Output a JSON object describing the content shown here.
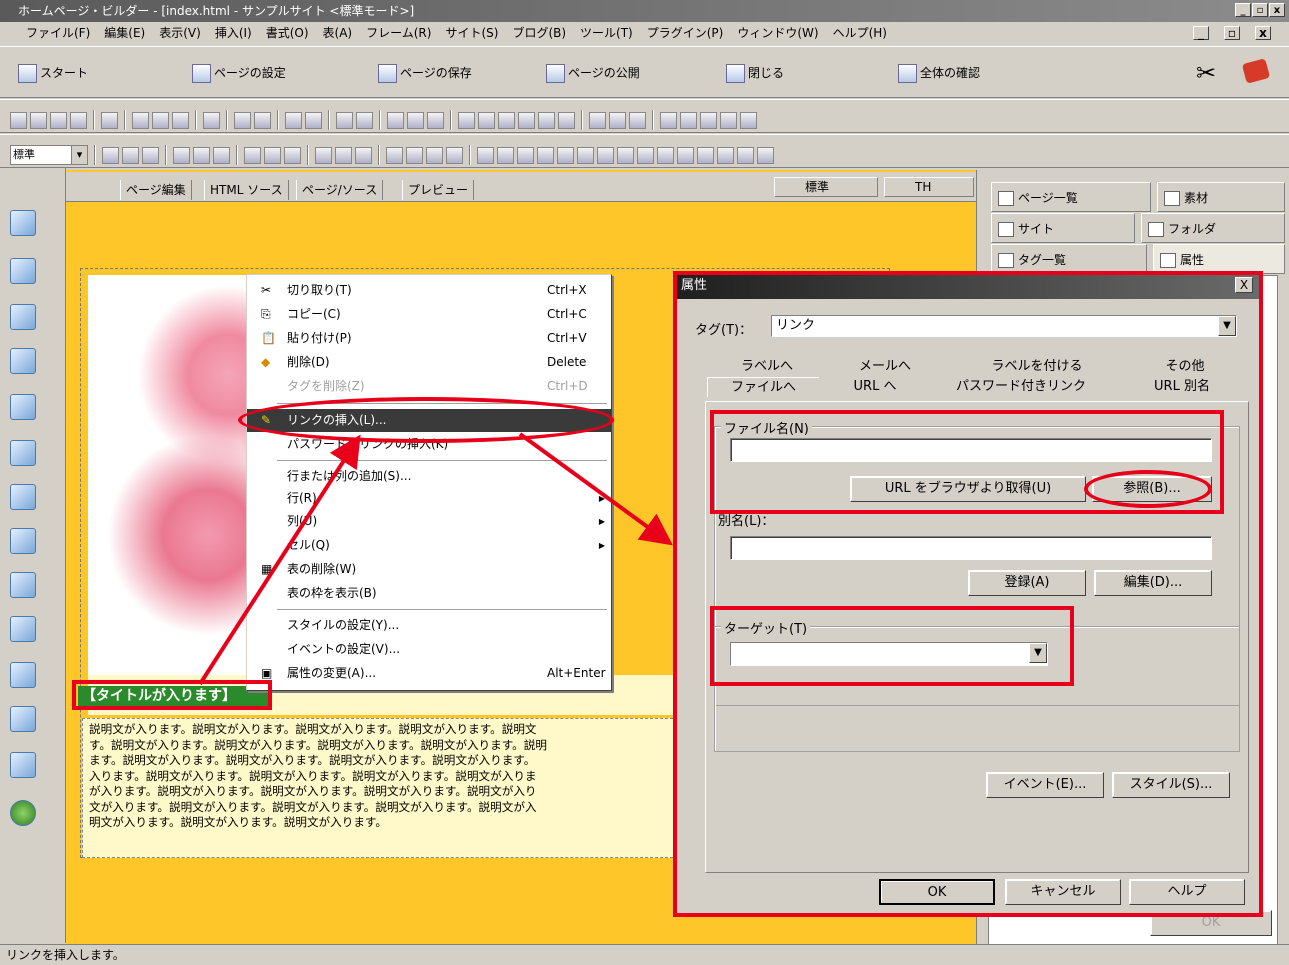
{
  "window": {
    "title": "ホームページ・ビルダー - [index.html - サンプルサイト <標準モード>]",
    "controls": [
      "_",
      "▫",
      "x"
    ]
  },
  "menu": [
    "ファイル(F)",
    "編集(E)",
    "表示(V)",
    "挿入(I)",
    "書式(O)",
    "表(A)",
    "フレーム(R)",
    "サイト(S)",
    "ブログ(B)",
    "ツール(T)",
    "プラグイン(P)",
    "ウィンドウ(W)",
    "ヘルプ(H)"
  ],
  "big_toolbar": [
    "スタート",
    "ページの設定",
    "ページの保存",
    "ページの公開",
    "閉じる",
    "全体の確認"
  ],
  "format_toolbar": {
    "style": "標準"
  },
  "editor_tabs": [
    "ページ編集",
    "HTML ソース",
    "ページ/ソース",
    "プレビュー"
  ],
  "editor_selects": {
    "left": "標準",
    "right": "TH"
  },
  "page_content": {
    "heading": "【タイトルが入ります】",
    "description_lines": [
      "説明文が入ります。説明文が入ります。説明文が入ります。説明文が入ります。説明文",
      "す。説明文が入ります。説明文が入ります。説明文が入ります。説明文が入ります。説明",
      "ます。説明文が入ります。説明文が入ります。説明文が入ります。説明文が入ります。",
      "入ります。説明文が入ります。説明文が入ります。説明文が入ります。説明文が入りま",
      "が入ります。説明文が入ります。説明文が入ります。説明文が入ります。説明文が入り",
      "文が入ります。説明文が入ります。説明文が入ります。説明文が入ります。説明文が入",
      "明文が入ります。説明文が入ります。説明文が入ります。"
    ]
  },
  "context_menu": {
    "items": [
      {
        "icon": "✂",
        "label": "切り取り(T)",
        "shortcut": "Ctrl+X"
      },
      {
        "icon": "⎘",
        "label": "コピー(C)",
        "shortcut": "Ctrl+C"
      },
      {
        "icon": "📋",
        "label": "貼り付け(P)",
        "shortcut": "Ctrl+V"
      },
      {
        "icon": "◆",
        "label": "削除(D)",
        "shortcut": "Delete"
      },
      {
        "icon": "",
        "label": "タグを削除(Z)",
        "shortcut": "Ctrl+D"
      },
      {
        "icon": "✎",
        "label": "リンクの挿入(L)...",
        "shortcut": ""
      },
      {
        "icon": "",
        "label": "パスワード付リンクの挿入(K)",
        "shortcut": ""
      },
      {
        "icon": "",
        "label": "行または列の追加(S)...",
        "shortcut": ""
      },
      {
        "icon": "",
        "label": "行(R)",
        "shortcut": ""
      },
      {
        "icon": "",
        "label": "列(U)",
        "shortcut": ""
      },
      {
        "icon": "",
        "label": "セル(Q)",
        "shortcut": ""
      },
      {
        "icon": "▦",
        "label": "表の削除(W)",
        "shortcut": ""
      },
      {
        "icon": "",
        "label": "表の枠を表示(B)",
        "shortcut": ""
      },
      {
        "icon": "",
        "label": "スタイルの設定(Y)...",
        "shortcut": ""
      },
      {
        "icon": "",
        "label": "イベントの設定(V)...",
        "shortcut": ""
      },
      {
        "icon": "▣",
        "label": "属性の変更(A)...",
        "shortcut": "Alt+Enter"
      }
    ]
  },
  "right_panel": {
    "tabs": [
      "ページ一覧",
      "素材",
      "サイト",
      "フォルダ",
      "タグ一覧",
      "属性"
    ],
    "ok_label": "OK"
  },
  "dialog": {
    "title": "属性",
    "close": "X",
    "tag_label": "タグ(T)：",
    "tag_value": "リンク",
    "tabs_row1": [
      "ラベルへ",
      "メールへ",
      "ラベルを付ける",
      "その他"
    ],
    "tabs_row2": [
      "ファイルへ",
      "URL へ",
      "パスワード付きリンク",
      "URL 別名"
    ],
    "filename_group": "ファイル名(N)",
    "filename_value": "",
    "url_button": "URL をブラウザより取得(U)",
    "browse_button": "参照(B)...",
    "alias_label": "別名(L)：",
    "alias_value": "",
    "register_button": "登録(A)",
    "edit_button": "編集(D)...",
    "target_group": "ターゲット(T)",
    "target_value": "",
    "event_button": "イベント(E)...",
    "style_button": "スタイル(S)...",
    "ok": "OK",
    "cancel": "キャンセル",
    "help": "ヘルプ"
  },
  "status": "リンクを挿入します。",
  "colors": {
    "annotation": "#e8001a",
    "editor_bg": "#ffc62a",
    "heading_bg": "#2b8a2b"
  }
}
